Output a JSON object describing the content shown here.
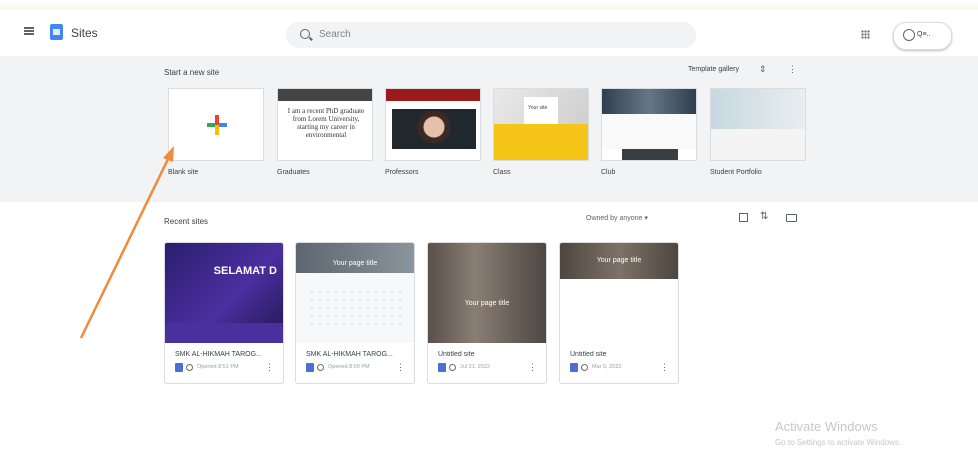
{
  "header": {
    "app_name": "Sites",
    "search_placeholder": "Search",
    "account_label": "Q≡.."
  },
  "templates": {
    "section_title": "Start a new site",
    "gallery_label": "Template gallery",
    "items": [
      {
        "name": "Blank site"
      },
      {
        "name": "Graduates",
        "card_text": "I am a recent PhD graduate from Lorem University, starting my career in environmental"
      },
      {
        "name": "Professors"
      },
      {
        "name": "Class",
        "card_text": "Your site"
      },
      {
        "name": "Club"
      },
      {
        "name": "Student Portfolio"
      }
    ]
  },
  "recent": {
    "section_title": "Recent sites",
    "owner_filter": "Owned by anyone ▾",
    "sites": [
      {
        "title": "SMK AL-HIKMAH TAROG...",
        "thumb_text": "SELAMAT D",
        "date": "Opened 8:51 PM"
      },
      {
        "title": "SMK AL-HIKMAH TAROG...",
        "thumb_text": "Your page title",
        "date": "Opened 8:09 PM"
      },
      {
        "title": "Untitled site",
        "thumb_text": "Your page title",
        "date": "Jul 31, 2022"
      },
      {
        "title": "Untitled site",
        "thumb_text": "Your page title",
        "date": "Mar 5, 2022"
      }
    ]
  },
  "watermark": {
    "title": "Activate Windows",
    "subtitle": "Go to Settings to activate Windows."
  },
  "colors": {
    "brand": "#4285f4",
    "annotation_arrow": "#f08a3c"
  }
}
